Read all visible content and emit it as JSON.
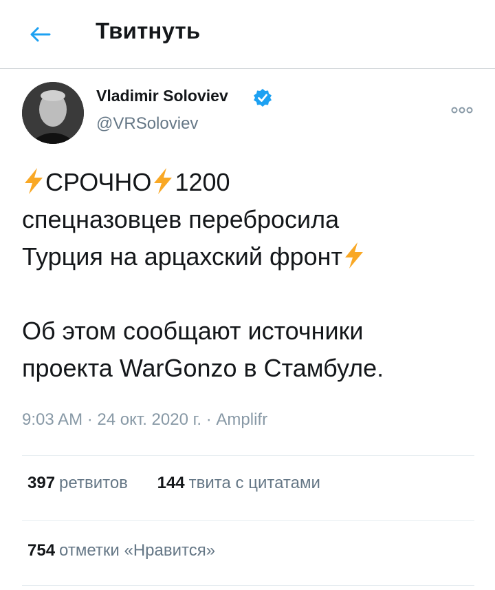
{
  "header": {
    "title": "Твитнуть"
  },
  "author": {
    "name": "Vladimir Soloviev",
    "handle": "@VRSoloviev"
  },
  "tweet": {
    "line1_a": "СРОЧНО",
    "line1_b": "1200",
    "line2": "спецназовцев перебросила",
    "line3": "Турция на арцахский фронт",
    "line4": "Об этом сообщают источники",
    "line5": "проекта WarGonzo в Стамбуле."
  },
  "meta": {
    "time": "9:03 AM",
    "date": "24 окт. 2020 г.",
    "source": "Amplifr",
    "separator": " · "
  },
  "stats": {
    "retweets_count": "397",
    "retweets_label": "ретвитов",
    "quotes_count": "144",
    "quotes_label": "твита с цитатами",
    "likes_count": "754",
    "likes_label": "отметки «Нравится»"
  },
  "colors": {
    "accent": "#1da1f2",
    "bolt": "#f9a825",
    "muted": "#657786"
  },
  "icons": {
    "back": "arrow-left-icon",
    "verified": "verified-badge-icon",
    "more": "more-options-icon",
    "bolt": "lightning-bolt-emoji"
  }
}
